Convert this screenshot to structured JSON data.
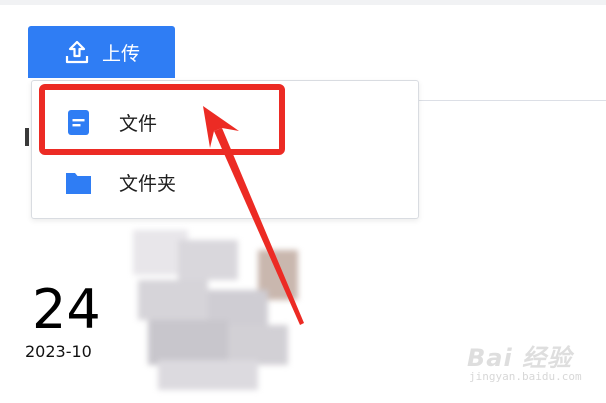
{
  "toolbar": {
    "upload_label": "上传",
    "upload_icon": "upload-icon",
    "accent_color": "#2f7df4"
  },
  "upload_menu": {
    "items": [
      {
        "label": "文件",
        "icon": "file-icon"
      },
      {
        "label": "文件夹",
        "icon": "folder-icon"
      }
    ]
  },
  "annotation": {
    "highlight_color": "#ec2b24",
    "highlighted_item": "文件"
  },
  "date_card": {
    "day": "24",
    "year_month": "2023-10"
  },
  "watermark": {
    "logo": "Bai 经验",
    "url": "jingyan.baidu.com"
  }
}
